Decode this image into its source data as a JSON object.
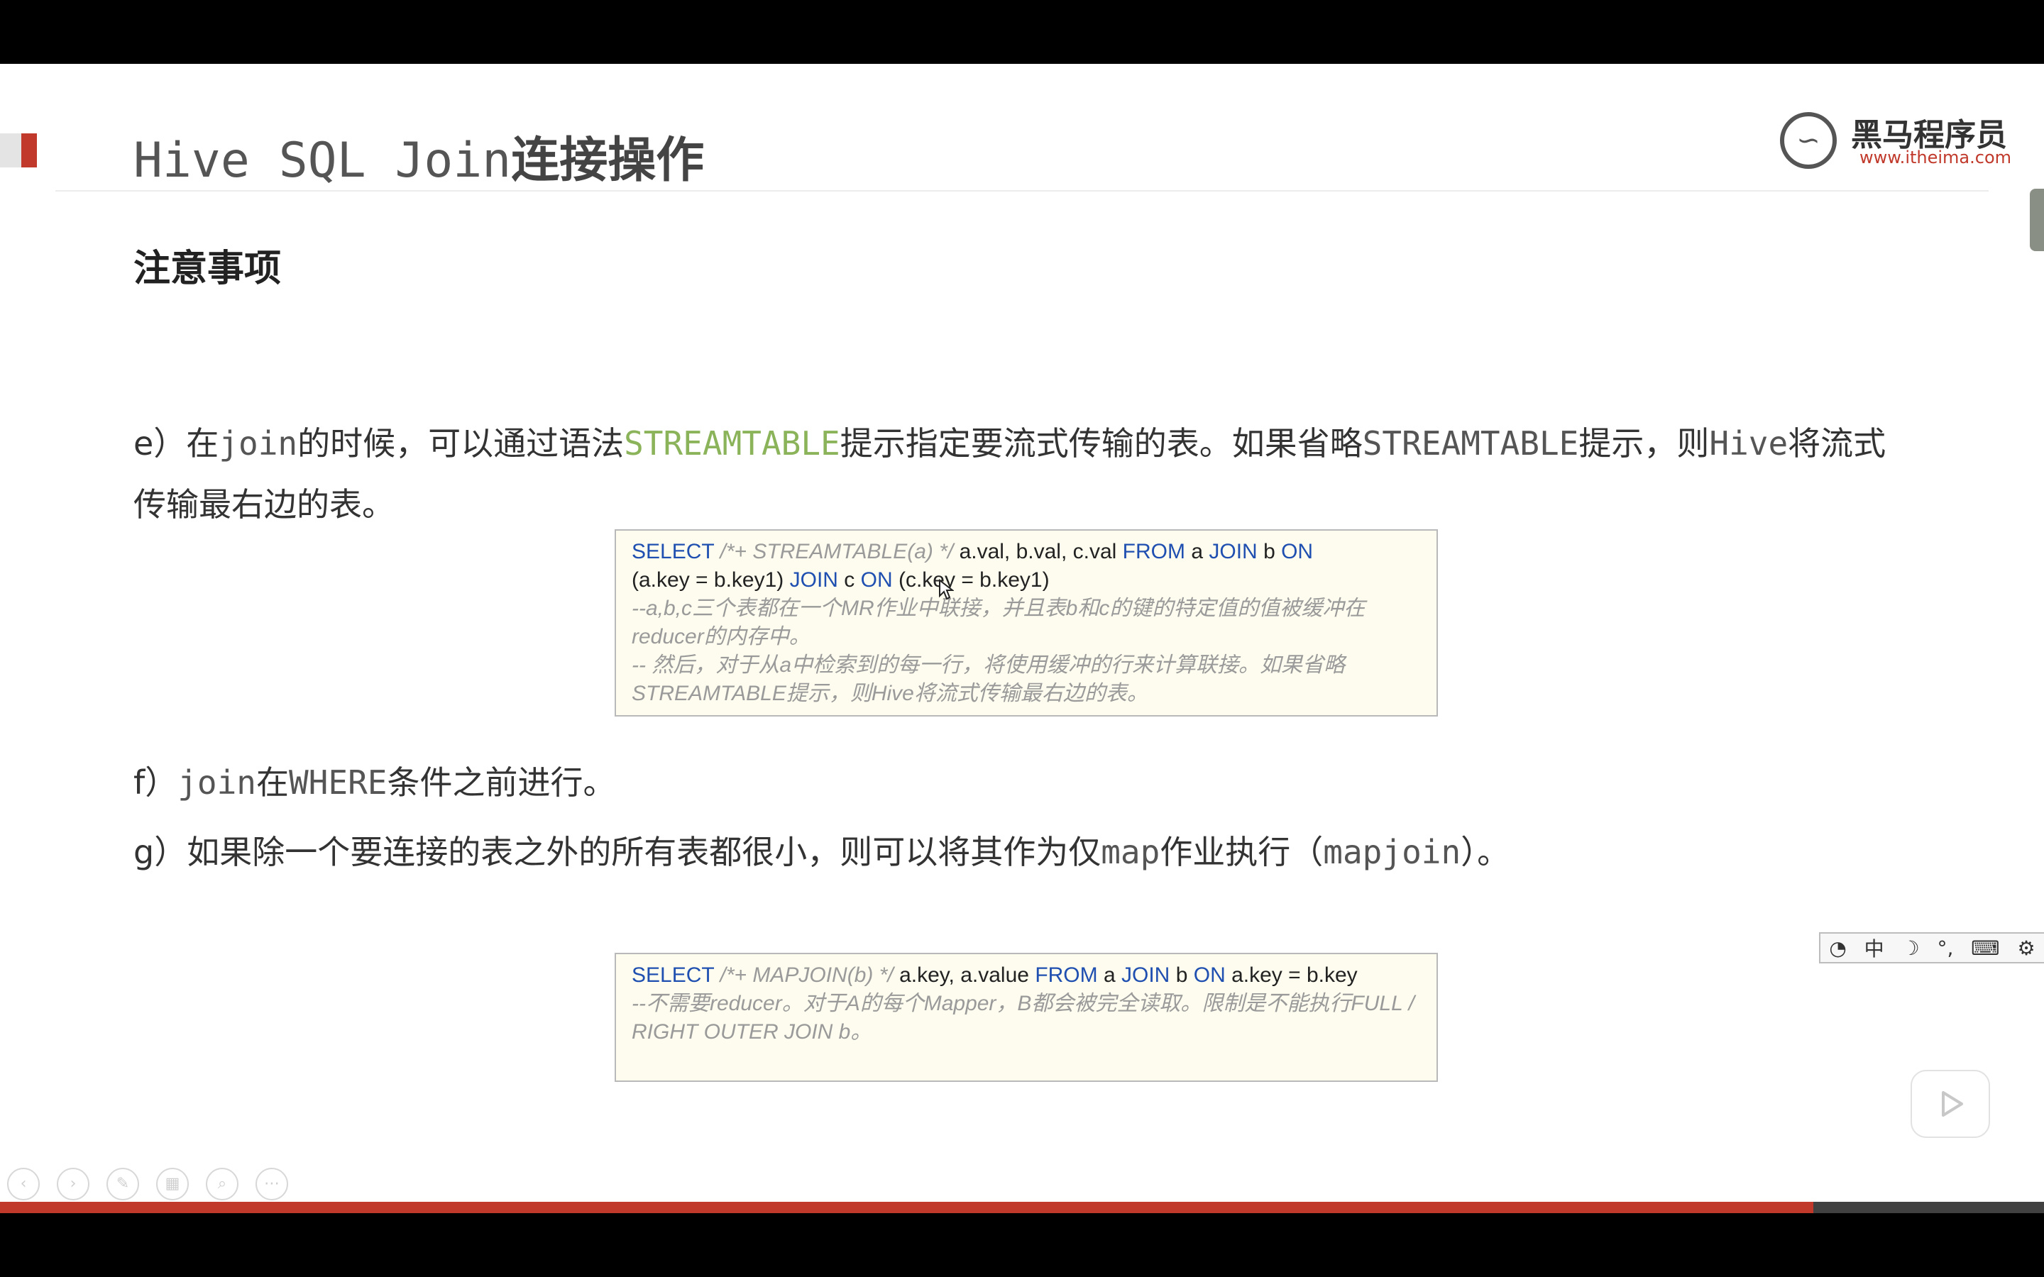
{
  "title": {
    "en": "Hive SQL Join",
    "zh": "连接操作"
  },
  "logo": {
    "name": "黑马程序员",
    "url": "www.itheima.com"
  },
  "section_heading": "注意事项",
  "para_e": {
    "prefix": "e）在",
    "join": "join",
    "t1": "的时候，可以通过语法",
    "streamtable": "STREAMTABLE",
    "t2": "提示指定要流式传输的表。如果省略",
    "streamtable2": "STREAMTABLE",
    "t3": "提示，则",
    "hive": "Hive",
    "t4": "将流式传输最右边的表。"
  },
  "code1": {
    "select": "SELECT",
    "hint": "/*+ STREAMTABLE(a) */",
    "cols": "a.val, b.val, c.val",
    "from": "FROM",
    "a": "a",
    "join1": "JOIN",
    "b": "b",
    "on1": "ON",
    "cond1": "(a.key = b.key1)",
    "join2": "JOIN",
    "c": "c",
    "on2": "ON",
    "cond2": "(c.key = b.key1)",
    "comment1": "--a,b,c三个表都在一个MR作业中联接，并且表b和c的键的特定值的值被缓冲在reducer的内存中。",
    "comment2": "-- 然后，对于从a中检索到的每一行，将使用缓冲的行来计算联接。如果省略STREAMTABLE提示，则Hive将流式传输最右边的表。"
  },
  "para_f": {
    "prefix": "f）",
    "join": "join",
    "t1": "在",
    "where": "WHERE",
    "t2": "条件之前进行。"
  },
  "para_g": {
    "prefix": "g）如果除一个要连接的表之外的所有表都很小，则可以将其作为仅",
    "map": "map",
    "t1": "作业执行（",
    "mapjoin": "mapjoin",
    "t2": "）。"
  },
  "code2": {
    "select": "SELECT",
    "hint": "/*+ MAPJOIN(b) */",
    "cols": "a.key, a.value",
    "from": "FROM",
    "a": "a",
    "join": "JOIN",
    "b": "b",
    "on": "ON",
    "cond": "a.key = b.key",
    "comment": "--不需要reducer。对于A的每个Mapper，B都会被完全读取。限制是不能执行FULL / RIGHT OUTER JOIN b。"
  },
  "ime": {
    "mode": "中",
    "moon_icon": "☽",
    "punct_icon": "°,",
    "keyboard_icon": "⌨",
    "settings_icon": "⚙"
  },
  "nav_tools": [
    "prev-icon",
    "next-icon",
    "pen-icon",
    "slides-icon",
    "zoom-icon",
    "more-icon"
  ],
  "progress": {
    "fraction": 0.887,
    "color": "#c0392b"
  },
  "colors": {
    "accent": "#c0392b",
    "keyword": "#1f4fb0",
    "code_bg": "#fefcee",
    "highlight_green": "#8bb35a"
  }
}
